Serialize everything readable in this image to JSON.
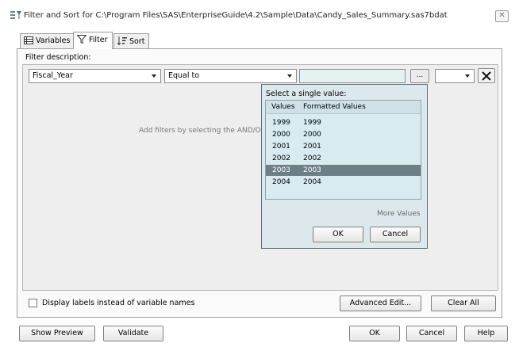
{
  "window": {
    "title": "Filter and Sort for C:\\Program Files\\SAS\\EnterpriseGuide\\4.2\\Sample\\Data\\Candy_Sales_Summary.sas7bdat",
    "close_glyph": "✕"
  },
  "tabs": [
    {
      "label": "Variables",
      "active": false
    },
    {
      "label": "Filter",
      "active": true
    },
    {
      "label": "Sort",
      "active": false
    }
  ],
  "filter": {
    "description_label": "Filter description:",
    "variable": "Fiscal_Year",
    "operator": "Equal to",
    "value": "",
    "ellipsis_label": "...",
    "connector": "",
    "remove_glyph": "✕",
    "hint": "Add filters by selecting the AND/OR"
  },
  "popup": {
    "title": "Select a single value:",
    "columns": [
      "Values",
      "Formatted Values"
    ],
    "rows": [
      {
        "value": "1999",
        "formatted": "1999",
        "selected": false
      },
      {
        "value": "2000",
        "formatted": "2000",
        "selected": false
      },
      {
        "value": "2001",
        "formatted": "2001",
        "selected": false
      },
      {
        "value": "2002",
        "formatted": "2002",
        "selected": false
      },
      {
        "value": "2003",
        "formatted": "2003",
        "selected": true
      },
      {
        "value": "2004",
        "formatted": "2004",
        "selected": false
      }
    ],
    "more_values": "More Values",
    "ok_label": "OK",
    "cancel_label": "Cancel"
  },
  "options": {
    "display_labels": "Display labels instead of variable names",
    "display_labels_checked": false,
    "advanced_edit": "Advanced Edit...",
    "clear_all": "Clear All"
  },
  "footer": {
    "show_preview": "Show Preview",
    "validate": "Validate",
    "ok": "OK",
    "cancel": "Cancel",
    "help": "Help"
  },
  "colors": {
    "selected_row": "#6d7f86",
    "popup_background": "#dde8ec",
    "list_background": "#d8ebf0"
  }
}
